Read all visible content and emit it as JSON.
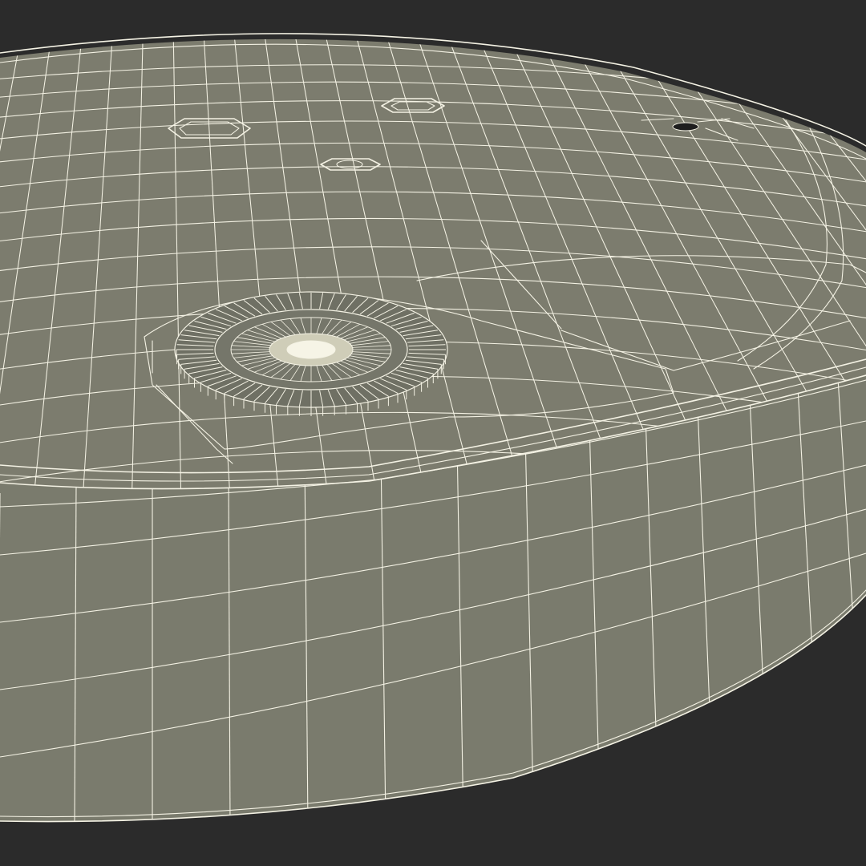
{
  "scene": {
    "subject": "wireframe-disc-device",
    "colors": {
      "background": "#2b2b2b",
      "surface_top": "#7c7c6e",
      "surface_side": "#7a7b6d",
      "wire": "#f4f2e4",
      "hole": "#1e1e1e"
    },
    "mesh": {
      "top_grid": true,
      "side_rows": 4,
      "gear_teeth": 72
    }
  }
}
